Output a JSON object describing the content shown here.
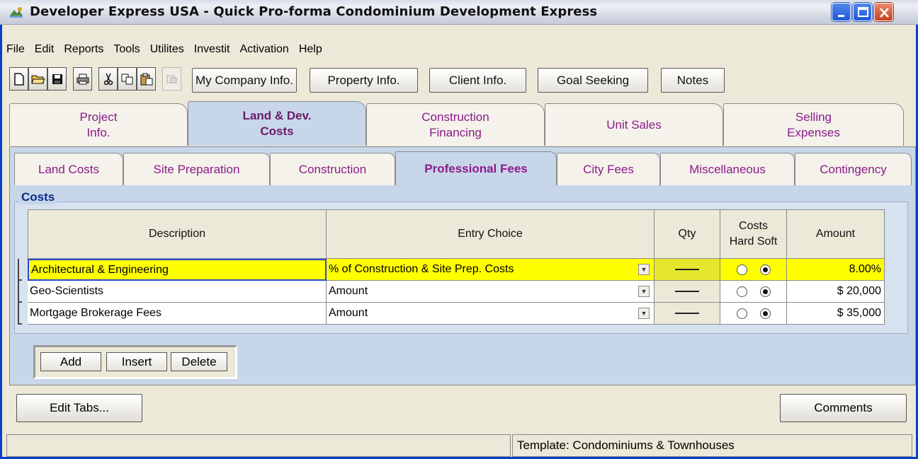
{
  "window": {
    "title": "Developer Express  USA - Quick Pro-forma Condominium Development Express"
  },
  "menu": [
    "File",
    "Edit",
    "Reports",
    "Tools",
    "Utilites",
    "Investit",
    "Activation",
    "Help"
  ],
  "toolbar": {
    "my_company": "My Company Info.",
    "property": "Property Info.",
    "client": "Client Info.",
    "goal_seeking": "Goal Seeking",
    "notes": "Notes"
  },
  "main_tabs": [
    {
      "label": "Project\nInfo."
    },
    {
      "label": "Land & Dev.\nCosts"
    },
    {
      "label": "Construction\nFinancing"
    },
    {
      "label": "Unit Sales"
    },
    {
      "label": "Selling\nExpenses"
    }
  ],
  "sub_tabs": [
    {
      "label": "Land Costs"
    },
    {
      "label": "Site Preparation"
    },
    {
      "label": "Construction"
    },
    {
      "label": "Professional Fees"
    },
    {
      "label": "City Fees"
    },
    {
      "label": "Miscellaneous"
    },
    {
      "label": "Contingency"
    }
  ],
  "costs": {
    "legend": "Costs",
    "headers": {
      "description": "Description",
      "entry_choice": "Entry Choice",
      "qty": "Qty",
      "costs_line1": "Costs",
      "costs_line2": "Hard Soft",
      "amount": "Amount"
    },
    "rows": [
      {
        "description": "Architectural & Engineering",
        "entry_choice": "% of Construction & Site Prep. Costs",
        "qty": "—",
        "cost_type": "Soft",
        "amount": "8.00%"
      },
      {
        "description": "Geo-Scientists",
        "entry_choice": "Amount",
        "qty": "—",
        "cost_type": "Soft",
        "amount": "$ 20,000"
      },
      {
        "description": "Mortgage Brokerage Fees",
        "entry_choice": "Amount",
        "qty": "—",
        "cost_type": "Soft",
        "amount": "$ 35,000"
      }
    ]
  },
  "row_buttons": {
    "add": "Add",
    "insert": "Insert",
    "delete": "Delete"
  },
  "edit_tabs": "Edit Tabs...",
  "comments": "Comments",
  "status": {
    "template": "Template: Condominiums & Townhouses"
  },
  "colors": {
    "tab_text": "#8b1a8b",
    "active_tab_bg": "#c7d6e8",
    "highlight_row": "#ffff00",
    "title_blue": "#0a3fc8"
  }
}
